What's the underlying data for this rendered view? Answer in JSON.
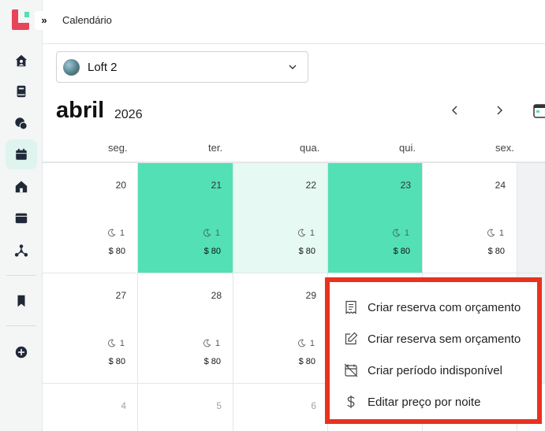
{
  "header": {
    "breadcrumb": "Calendário",
    "expand_glyph": "»"
  },
  "sidebar": {
    "items": [
      {
        "icon": "home-user-icon"
      },
      {
        "icon": "book-icon"
      },
      {
        "icon": "chat-icon"
      },
      {
        "icon": "calendar-icon",
        "active": true
      },
      {
        "icon": "house-icon"
      },
      {
        "icon": "browser-icon"
      },
      {
        "icon": "network-icon"
      },
      {
        "icon": "bookmark-icon"
      },
      {
        "icon": "plus-circle-icon"
      }
    ]
  },
  "property_select": {
    "value": "Loft 2"
  },
  "calendar": {
    "month": "abril",
    "year": "2026",
    "weekdays": [
      "seg.",
      "ter.",
      "qua.",
      "qui.",
      "sex."
    ],
    "week1": [
      {
        "day": "20",
        "nights": "1",
        "price": "$ 80"
      },
      {
        "day": "21",
        "nights": "1",
        "price": "$ 80"
      },
      {
        "day": "22",
        "nights": "1",
        "price": "$ 80"
      },
      {
        "day": "23",
        "nights": "1",
        "price": "$ 80"
      },
      {
        "day": "24",
        "nights": "1",
        "price": "$ 80"
      }
    ],
    "week2": [
      {
        "day": "27",
        "nights": "1",
        "price": "$ 80"
      },
      {
        "day": "28",
        "nights": "1",
        "price": "$ 80"
      },
      {
        "day": "29",
        "nights": "1",
        "price": "$ 80"
      }
    ],
    "week3": [
      {
        "day": "4"
      },
      {
        "day": "5"
      },
      {
        "day": "6"
      }
    ]
  },
  "context_menu": {
    "items": [
      {
        "label": "Criar reserva com orçamento",
        "icon": "receipt-icon"
      },
      {
        "label": "Criar reserva sem orçamento",
        "icon": "edit-icon"
      },
      {
        "label": "Criar período indisponível",
        "icon": "calendar-off-icon"
      },
      {
        "label": "Editar preço por noite",
        "icon": "dollar-icon"
      }
    ]
  },
  "colors": {
    "accent": "#52e0b4",
    "accent_light": "#e6f9f3",
    "brand": "#e8445a",
    "highlight_border": "#e8321e"
  }
}
